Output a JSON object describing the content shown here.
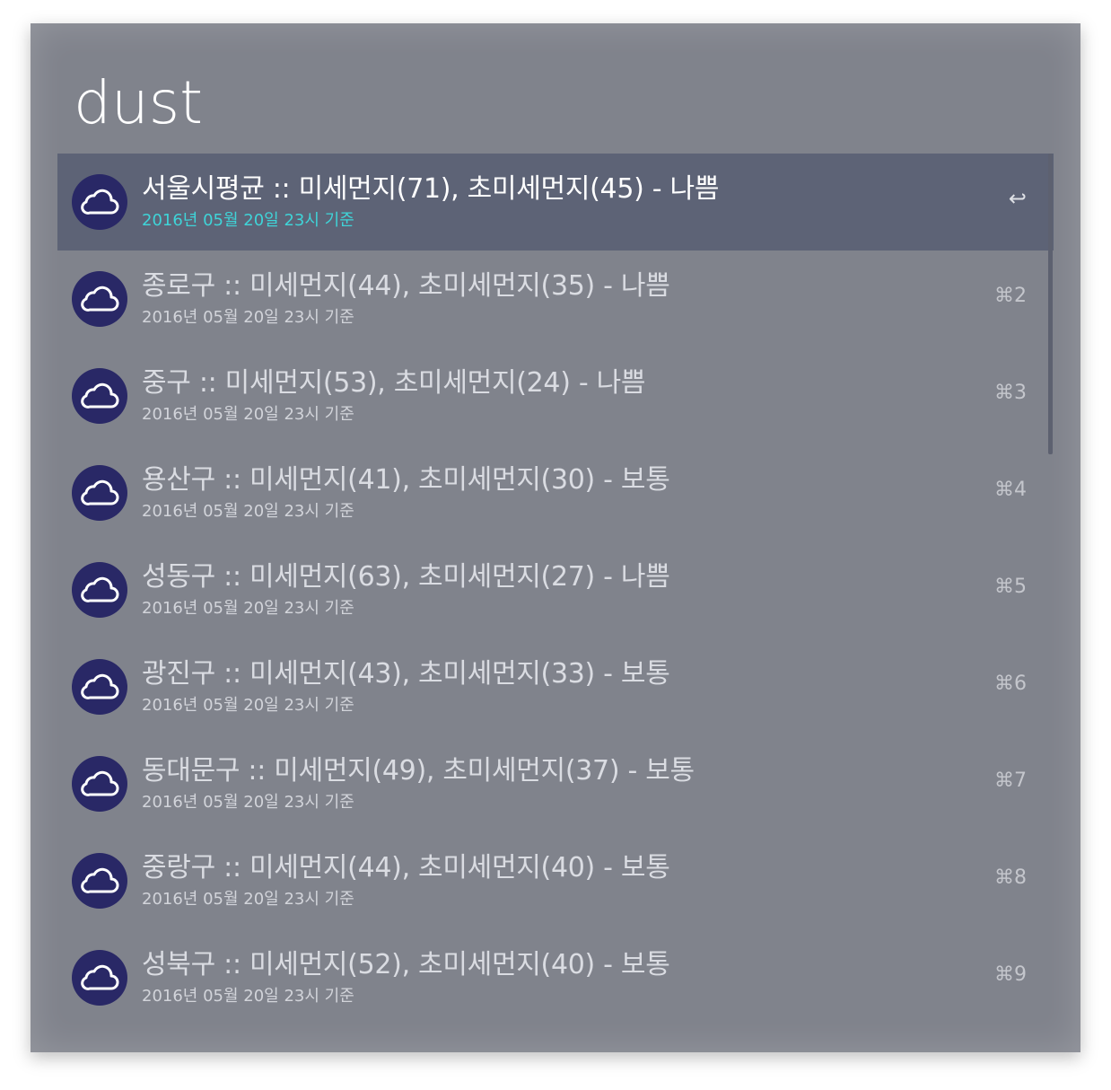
{
  "search": {
    "query": "dust"
  },
  "results": [
    {
      "title": "서울시평균 :: 미세먼지(71), 초미세먼지(45) - 나쁨",
      "subtitle": "2016년 05월 20일 23시 기준",
      "shortcut": "↩",
      "icon": "cloud-icon"
    },
    {
      "title": "종로구 :: 미세먼지(44), 초미세먼지(35) - 나쁨",
      "subtitle": "2016년 05월 20일 23시 기준",
      "shortcut": "⌘2",
      "icon": "cloud-icon"
    },
    {
      "title": "중구 :: 미세먼지(53), 초미세먼지(24) - 나쁨",
      "subtitle": "2016년 05월 20일 23시 기준",
      "shortcut": "⌘3",
      "icon": "cloud-icon"
    },
    {
      "title": "용산구 :: 미세먼지(41), 초미세먼지(30) - 보통",
      "subtitle": "2016년 05월 20일 23시 기준",
      "shortcut": "⌘4",
      "icon": "cloud-icon"
    },
    {
      "title": "성동구 :: 미세먼지(63), 초미세먼지(27) - 나쁨",
      "subtitle": "2016년 05월 20일 23시 기준",
      "shortcut": "⌘5",
      "icon": "cloud-icon"
    },
    {
      "title": "광진구 :: 미세먼지(43), 초미세먼지(33) - 보통",
      "subtitle": "2016년 05월 20일 23시 기준",
      "shortcut": "⌘6",
      "icon": "cloud-icon"
    },
    {
      "title": "동대문구 :: 미세먼지(49), 초미세먼지(37) - 보통",
      "subtitle": "2016년 05월 20일 23시 기준",
      "shortcut": "⌘7",
      "icon": "cloud-icon"
    },
    {
      "title": "중랑구 :: 미세먼지(44), 초미세먼지(40) - 보통",
      "subtitle": "2016년 05월 20일 23시 기준",
      "shortcut": "⌘8",
      "icon": "cloud-icon"
    },
    {
      "title": "성북구 :: 미세먼지(52), 초미세먼지(40) - 보통",
      "subtitle": "2016년 05월 20일 23시 기준",
      "shortcut": "⌘9",
      "icon": "cloud-icon"
    }
  ],
  "colors": {
    "window_background": "#80838c",
    "selected_row": "#5d6376",
    "selected_subtitle": "#3fd4d8",
    "icon_background": "#292866"
  }
}
